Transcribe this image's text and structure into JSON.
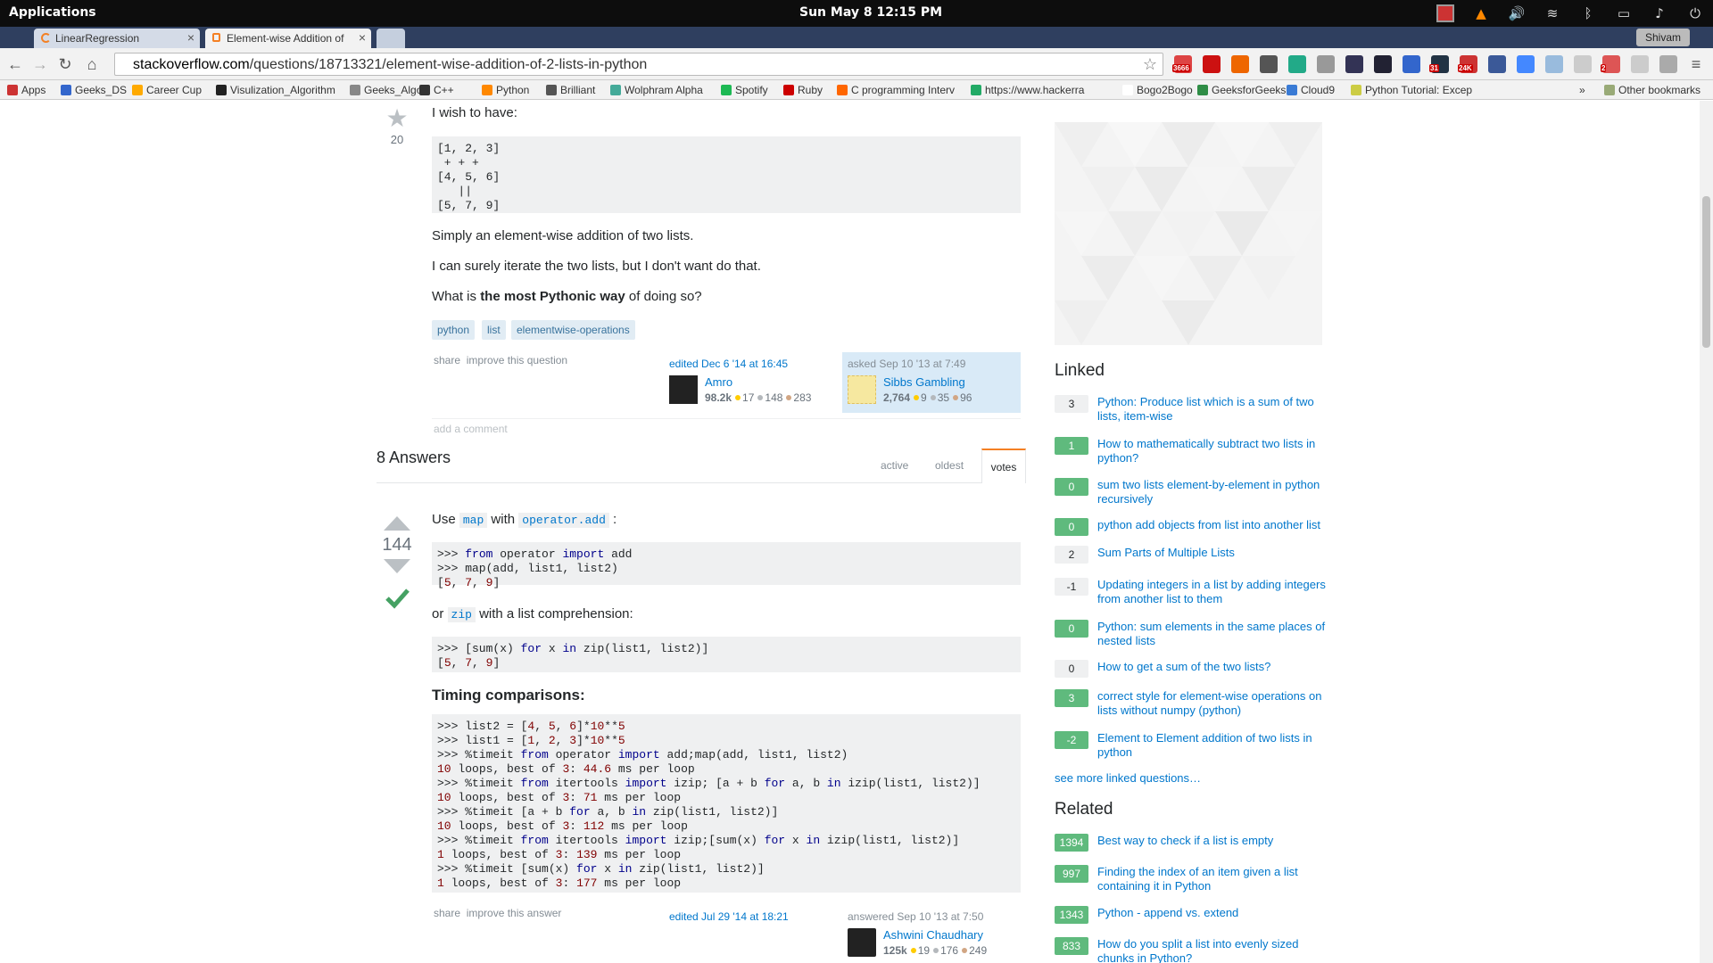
{
  "os": {
    "apps_label": "Applications",
    "clock": "Sun May  8   12:15 PM",
    "user": "Shivam"
  },
  "tabs": [
    {
      "label": "LinearRegression"
    },
    {
      "label": "Element-wise Addition of"
    }
  ],
  "url": {
    "domain": "stackoverflow.com",
    "path": "/questions/18713321/element-wise-addition-of-2-lists-in-python"
  },
  "extensions": [
    {
      "name": "gmail-icon",
      "badge": "3666",
      "color": "#d44"
    },
    {
      "name": "acrobat-icon",
      "badge": "",
      "color": "#c11"
    },
    {
      "name": "fire-icon",
      "badge": "",
      "color": "#e60"
    },
    {
      "name": "gear-ext-icon",
      "badge": "",
      "color": "#555"
    },
    {
      "name": "drive-icon",
      "badge": "",
      "color": "#2a8"
    },
    {
      "name": "download-icon",
      "badge": "",
      "color": "#999"
    },
    {
      "name": "block-icon",
      "badge": "",
      "color": "#335"
    },
    {
      "name": "h-icon",
      "badge": "",
      "color": "#223"
    },
    {
      "name": "tool-icon",
      "badge": "",
      "color": "#36c"
    },
    {
      "name": "brackets-icon",
      "badge": "31",
      "color": "#234"
    },
    {
      "name": "mail-icon",
      "badge": "24K",
      "color": "#c33"
    },
    {
      "name": "facebook-icon",
      "badge": "",
      "color": "#3b5998"
    },
    {
      "name": "translate-icon",
      "badge": "",
      "color": "#48f"
    },
    {
      "name": "dropbox-icon",
      "badge": "",
      "color": "#9bd"
    },
    {
      "name": "circle-icon",
      "badge": "",
      "color": "#ccc"
    },
    {
      "name": "ext-red-icon",
      "badge": "2",
      "color": "#d55"
    },
    {
      "name": "globe-icon",
      "badge": "",
      "color": "#ccc"
    },
    {
      "name": "shield-ext-icon",
      "badge": "",
      "color": "#aaa"
    }
  ],
  "bookmarks": [
    "Apps",
    "Geeks_DS",
    "Career Cup",
    "Visulization_Algorithm",
    "Geeks_Algo",
    "C++",
    "Python",
    "Brilliant",
    "Wolphram Alpha",
    "Spotify",
    "Ruby",
    "C programming Interv",
    "https://www.hackerra",
    "Bogo2Bogo",
    "GeeksforGeeks",
    "Cloud9",
    "Python Tutorial: Excep",
    "Other bookmarks"
  ],
  "question": {
    "votes": "20",
    "wish": "I wish to have:",
    "code": "[1, 2, 3]\n + + +\n[4, 5, 6]\n   ||\n[5, 7, 9]",
    "p1": "Simply an element-wise addition of two lists.",
    "p2": "I can surely iterate the two lists, but I don't want do that.",
    "p3_pre": "What is ",
    "p3_bold": "the most Pythonic way",
    "p3_post": " of doing so?",
    "tags": [
      "python",
      "list",
      "elementwise-operations"
    ],
    "share": "share",
    "improve": "improve this question",
    "edited": "edited Dec 6 '14 at 16:45",
    "editor": {
      "name": "Amro",
      "rep": "98.2k",
      "gold": "17",
      "silver": "148",
      "bronze": "283"
    },
    "asked": "asked Sep 10 '13 at 7:49",
    "asker": {
      "name": "Sibbs Gambling",
      "rep": "2,764",
      "gold": "9",
      "silver": "35",
      "bronze": "96"
    },
    "add_comment": "add a comment"
  },
  "answers": {
    "count_label": "8 Answers",
    "sort_tabs": [
      "active",
      "oldest",
      "votes"
    ],
    "votes": "144",
    "use": "Use ",
    "map": "map",
    "with": " with ",
    "opadd": "operator.add",
    "colon": " :",
    "or": "or ",
    "zip": "zip",
    "listcomp": " with a list comprehension:",
    "timing_heading": "Timing comparisons:",
    "share": "share",
    "improve": "improve this answer",
    "edited": "edited Jul 29 '14 at 18:21",
    "answered": "answered Sep 10 '13 at 7:50",
    "answerer": {
      "name": "Ashwini Chaudhary",
      "rep": "125k",
      "gold": "19",
      "silver": "176",
      "bronze": "249"
    }
  },
  "linked": {
    "heading": "Linked",
    "items": [
      {
        "score": "3",
        "title": "Python: Produce list which is a sum of two lists, item-wise",
        "accepted": false
      },
      {
        "score": "1",
        "title": "How to mathematically subtract two lists in python?",
        "accepted": true
      },
      {
        "score": "0",
        "title": "sum two lists element-by-element in python recursively",
        "accepted": true
      },
      {
        "score": "0",
        "title": "python add objects from list into another list",
        "accepted": true
      },
      {
        "score": "2",
        "title": "Sum Parts of Multiple Lists",
        "accepted": false
      },
      {
        "score": "-1",
        "title": "Updating integers in a list by adding integers from another list to them",
        "accepted": false
      },
      {
        "score": "0",
        "title": "Python: sum elements in the same places of nested lists",
        "accepted": true
      },
      {
        "score": "0",
        "title": "How to get a sum of the two lists?",
        "accepted": false
      },
      {
        "score": "3",
        "title": "correct style for element-wise operations on lists without numpy (python)",
        "accepted": true
      },
      {
        "score": "-2",
        "title": "Element to Element addition of two lists in python",
        "accepted": true
      }
    ],
    "more": "see more linked questions…"
  },
  "related": {
    "heading": "Related",
    "items": [
      {
        "score": "1394",
        "title": "Best way to check if a list is empty"
      },
      {
        "score": "997",
        "title": "Finding the index of an item given a list containing it in Python"
      },
      {
        "score": "1343",
        "title": "Python - append vs. extend"
      },
      {
        "score": "833",
        "title": "How do you split a list into evenly sized chunks in Python?"
      }
    ]
  }
}
